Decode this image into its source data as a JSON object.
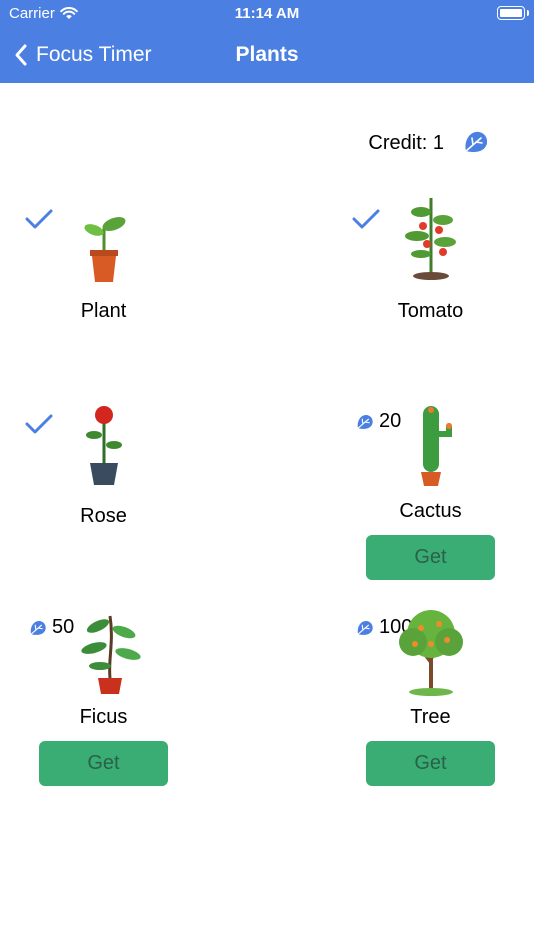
{
  "status_bar": {
    "carrier": "Carrier",
    "time": "11:14 AM"
  },
  "nav": {
    "back_label": "Focus Timer",
    "title": "Plants"
  },
  "credit": {
    "label": "Credit: 1"
  },
  "plants": [
    {
      "name": "Plant",
      "owned": true
    },
    {
      "name": "Tomato",
      "owned": true
    },
    {
      "name": "Rose",
      "owned": true
    },
    {
      "name": "Cactus",
      "owned": false,
      "cost": "20",
      "button": "Get"
    },
    {
      "name": "Ficus",
      "owned": false,
      "cost": "50",
      "button": "Get"
    },
    {
      "name": "Tree",
      "owned": false,
      "cost": "100",
      "button": "Get"
    }
  ],
  "colors": {
    "nav_bg": "#4b80e2",
    "accent": "#4b80e2",
    "button_bg": "#3aad74",
    "button_text": "#2a6148"
  }
}
